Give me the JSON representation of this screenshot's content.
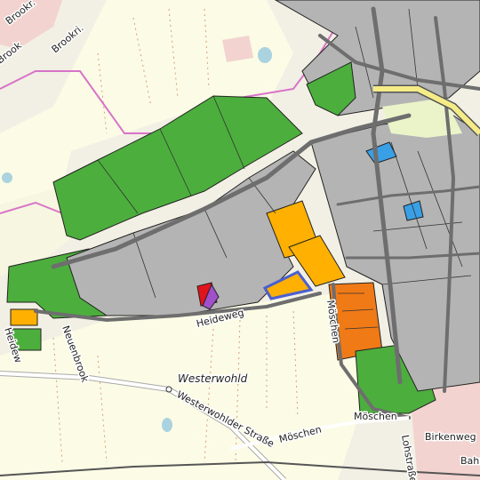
{
  "map": {
    "labels": {
      "brook": "Brook",
      "brookr": "Brookr.",
      "brookri": "Brookri.",
      "neuenbrook": "Neuenbrook",
      "heideweg_left": "Heidew",
      "heideweg": "Heideweg",
      "moeschen_vert": "Möschen",
      "westerwohld": "Westerwohld",
      "westerwohlder_strasse": "Westerwohlder Straße",
      "moeschen_road": "Möschen",
      "moeschen_road2": "Möschen",
      "birkenweg": "Birkenweg",
      "lohstrasse": "Lohstraße",
      "bahn": "Bahn"
    },
    "colors": {
      "background": "#f2efe4",
      "field": "#fbfbe6",
      "green_zone": "#4caf3d",
      "gray_zone": "#b4b4b4",
      "orange_zone": "#ffb000",
      "dark_orange_zone": "#f07a16",
      "red_zone": "#e1141e",
      "purple_zone": "#a050c8",
      "blue_zone": "#3aa0e6",
      "road": "#6e6e6e",
      "highway_fill": "#f5ec88",
      "boundary": "#d873c8",
      "residential": "#f2d3cf",
      "water": "#aad3df"
    }
  }
}
